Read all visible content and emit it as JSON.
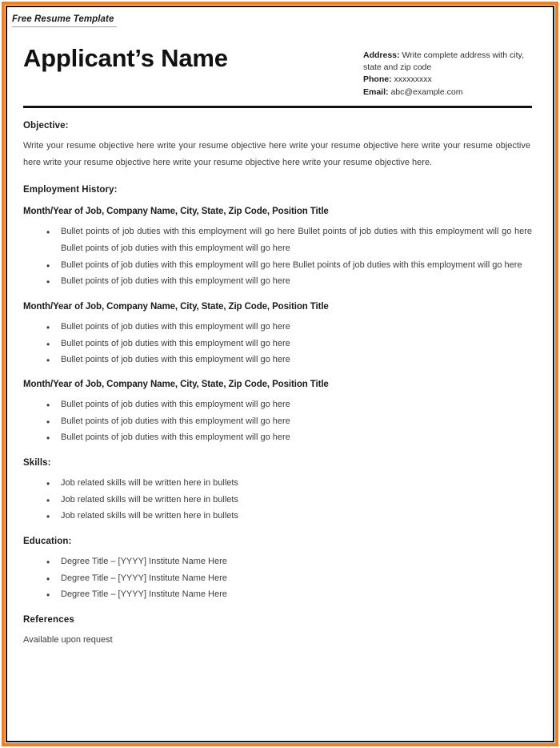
{
  "document": {
    "caption": "Free Resume Template",
    "applicant_name": "Applicant’s Name"
  },
  "contact": {
    "address_label": "Address:",
    "address_value": "Write complete address with city, state and zip code",
    "phone_label": "Phone:",
    "phone_value": "xxxxxxxxx",
    "email_label": "Email:",
    "email_value": "abc@example.com"
  },
  "objective": {
    "heading": "Objective:",
    "text": "Write your resume objective here write your resume objective here write your resume objective here write your resume objective here write your resume objective here write your resume objective here write your resume objective here."
  },
  "employment": {
    "heading": "Employment History:",
    "jobs": [
      {
        "title": "Month/Year of Job, Company Name, City, State, Zip Code, Position Title",
        "bullets": [
          "Bullet points of job duties with this employment will go here Bullet points of job duties with this employment will go here Bullet points of job duties with this employment will go here",
          "Bullet points of job duties with this employment will go here Bullet points of job duties with this employment will go here",
          "Bullet points of job duties with this employment will go here"
        ]
      },
      {
        "title": "Month/Year of Job, Company Name, City, State, Zip Code, Position Title",
        "bullets": [
          "Bullet points of job duties with this employment will go here",
          "Bullet points of job duties with this employment will go here",
          "Bullet points of job duties with this employment will go here"
        ]
      },
      {
        "title": "Month/Year of Job, Company Name, City, State, Zip Code, Position Title",
        "bullets": [
          "Bullet points of job duties with this employment will go here",
          "Bullet points of job duties with this employment will go here",
          "Bullet points of job duties with this employment will go here"
        ]
      }
    ]
  },
  "skills": {
    "heading": "Skills:",
    "items": [
      "Job related skills will be written here in bullets",
      "Job related skills will be written here in bullets",
      "Job related skills will be written here in bullets"
    ]
  },
  "education": {
    "heading": "Education:",
    "items": [
      "Degree Title – [YYYY] Institute Name Here",
      "Degree Title – [YYYY] Institute Name Here",
      "Degree Title – [YYYY] Institute Name Here"
    ]
  },
  "references": {
    "heading": "References",
    "text": "Available upon request"
  },
  "colors": {
    "frame_accent": "#ef8022",
    "frame_inner": "#141414",
    "heading_text": "#1b1b1b",
    "body_text": "#3c3c3c"
  }
}
